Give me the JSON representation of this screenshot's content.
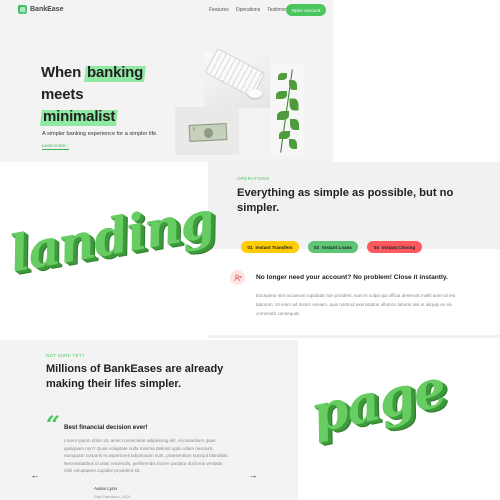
{
  "nav": {
    "logo_text": "BankEase",
    "links": [
      "Features",
      "Operations",
      "Testimonials"
    ],
    "cta": "Open account"
  },
  "hero": {
    "line1_pre": "When ",
    "line1_highlight": "banking",
    "line2": "meets",
    "line3_highlight": "minimalist",
    "subtitle": "A simpler banking experience for a simpler life.",
    "link": "Learn more ↓"
  },
  "decor": {
    "word_1": "landing",
    "word_2": "page"
  },
  "operations": {
    "eyebrow": "OPERATIONS",
    "title": "Everything as simple as possible, but no simpler.",
    "tabs": [
      {
        "num": "01",
        "label": "Instant Transfers",
        "color": "#ffcb03"
      },
      {
        "num": "02",
        "label": "Instant Loans",
        "color": "#5ec576"
      },
      {
        "num": "03",
        "label": "Instant Closing",
        "color": "#ff585f"
      }
    ],
    "card_title": "No longer need your account? No problem! Close it instantly.",
    "card_body": "Excepteur sint occaecat cupidatat non proident, sunt in culpa qui officia deserunt mollit anim id est laborum. Ut enim ad minim veniam, quis nostrud exercitation ullamco laboris nisi ut aliquip ex ea commodo consequat."
  },
  "testimonials": {
    "eyebrow": "NOT SURE YET?",
    "title": "Millions of BankEases are already making their lifes simpler.",
    "quote_mark": "“",
    "heading": "Best financial decision ever!",
    "body": "Lorem ipsum dolor sit, amet consectetur adipisicing elit. Accusantium quas quisquam non? Quas voluptate nulla minima deleniti optio ullam nesciunt, numquam corporis et asperiores laboriosam sunt, praesentium suscipit blanditiis. Necessitatibus id alias reiciendis, perferendis facere pariatur ducimus veritatis nihil voluptatem cupidite provident sit.",
    "name": "Aarav Lynn",
    "place": "San Francisco, USA",
    "prev": "←",
    "next": "→"
  }
}
